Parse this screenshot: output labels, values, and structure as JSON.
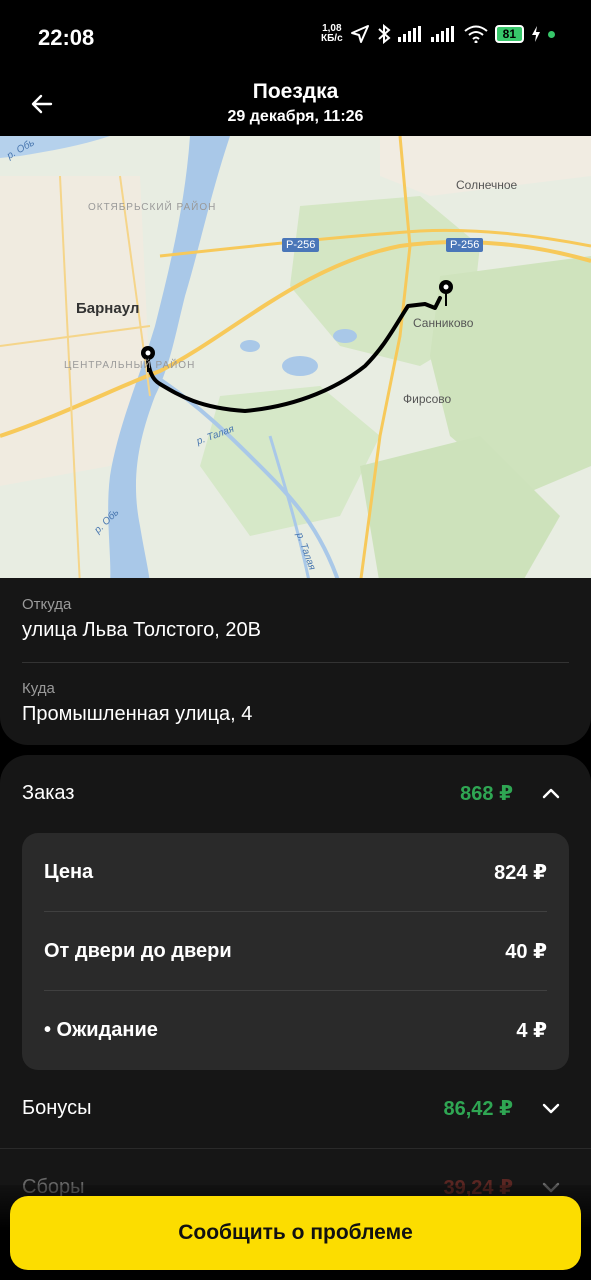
{
  "status": {
    "time": "22:08",
    "speed_value": "1,08",
    "speed_unit": "КБ/с",
    "battery": "81"
  },
  "header": {
    "title": "Поездка",
    "subtitle": "29 декабря, 11:26"
  },
  "map": {
    "labels": {
      "city": "Барнаул",
      "district_1": "ОКТЯБРЬСКИЙ РАЙОН",
      "district_2": "ЦЕНТРАЛЬНЫЙ РАЙОН",
      "solnechnoe": "Солнечное",
      "sannikovo": "Санниково",
      "firsovo": "Фирсово",
      "road_1": "Р-256",
      "road_2": "Р-256",
      "river_ob_1": "р. Обь",
      "river_ob_2": "р. Обь",
      "river_talaya_1": "р. Талая",
      "river_talaya_2": "р. Талая"
    }
  },
  "route": {
    "from_label": "Откуда",
    "from_value": "улица Льва Толстого, 20В",
    "to_label": "Куда",
    "to_value": "Промышленная улица, 4"
  },
  "order": {
    "label": "Заказ",
    "total": "868 ₽",
    "items": [
      {
        "label": "Цена",
        "value": "824 ₽"
      },
      {
        "label": "От двери до двери",
        "value": "40 ₽"
      },
      {
        "label": "• Ожидание",
        "value": "4 ₽"
      }
    ]
  },
  "bonuses": {
    "label": "Бонусы",
    "value": "86,42 ₽"
  },
  "fees": {
    "label": "Сборы",
    "value": "39,24 ₽"
  },
  "cta": {
    "label": "Сообщить о проблеме"
  },
  "colors": {
    "accent_yellow": "#fcdd00",
    "positive_green": "#2fa653",
    "negative_red": "#d9453a",
    "card_bg": "#161616",
    "inner_card_bg": "#2a2a2a"
  },
  "icons": [
    "back-arrow-icon",
    "location-arrow-icon",
    "bluetooth-icon",
    "signal-icon",
    "wifi-icon",
    "battery-icon",
    "chevron-up-icon",
    "chevron-down-icon",
    "pin-icon"
  ]
}
